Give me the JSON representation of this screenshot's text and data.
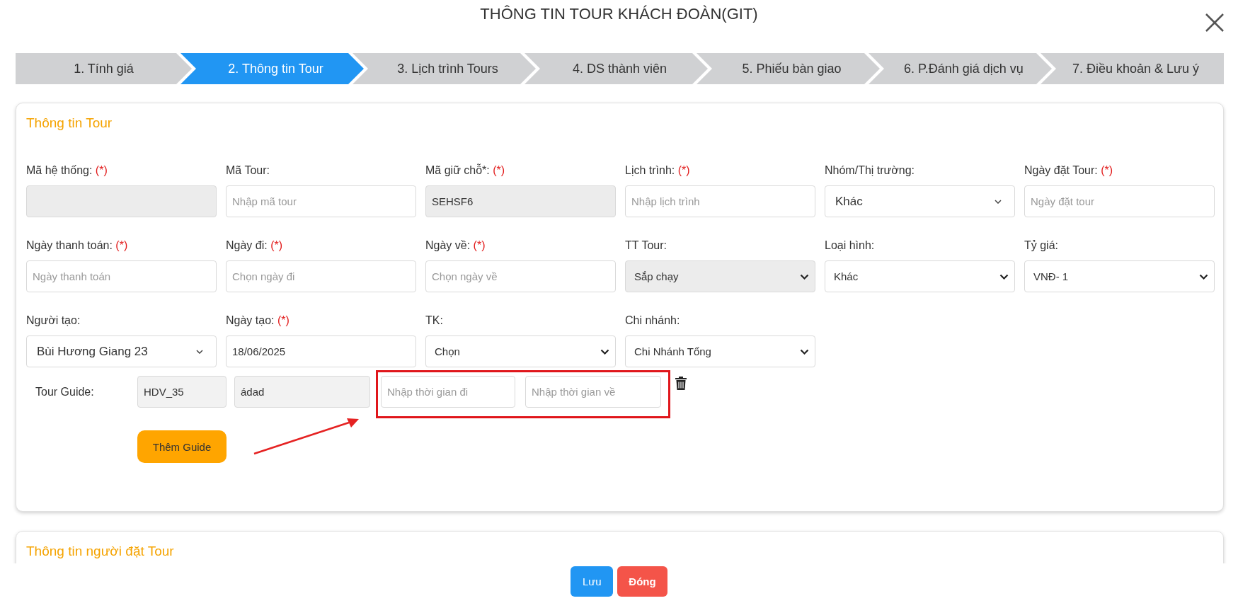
{
  "dialog": {
    "title": "THÔNG TIN TOUR KHÁCH ĐOÀN(GIT)"
  },
  "steps": [
    {
      "label": "1. Tính giá",
      "selected": false
    },
    {
      "label": "2. Thông tin Tour",
      "selected": true
    },
    {
      "label": "3. Lịch trình Tours",
      "selected": false
    },
    {
      "label": "4. DS thành viên",
      "selected": false
    },
    {
      "label": "5. Phiếu bàn giao",
      "selected": false
    },
    {
      "label": "6. P.Đánh giá dịch vụ",
      "selected": false
    },
    {
      "label": "7. Điều khoản & Lưu ý",
      "selected": false
    }
  ],
  "tour_info": {
    "title": "Thông tin Tour",
    "fields": [
      {
        "label": "Mã hệ thống:",
        "required_mark": "(*)",
        "kind": "input",
        "readonly": true
      },
      {
        "label": "Mã Tour:",
        "kind": "input",
        "readonly": false,
        "placeholder": "Nhập mã tour"
      },
      {
        "label": "Mã giữ chỗ*:",
        "required_mark": "(*)",
        "kind": "input",
        "readonly": true,
        "value": "SEHSF6"
      },
      {
        "label": "Lịch trình:",
        "required_mark": "(*)",
        "kind": "input",
        "readonly": false,
        "placeholder": "Nhập lịch trình"
      },
      {
        "label": "Nhóm/Thị trường:",
        "kind": "combo",
        "readonly": false,
        "value": "Khác"
      },
      {
        "label": "Ngày đặt Tour:",
        "required_mark": "(*)",
        "kind": "input",
        "readonly": false,
        "placeholder": "Ngày đặt tour"
      },
      {
        "label": "Ngày thanh toán:",
        "required_mark": "(*)",
        "kind": "input",
        "readonly": false,
        "placeholder": "Ngày thanh toán"
      },
      {
        "label": "Ngày đi:",
        "required_mark": "(*)",
        "kind": "input",
        "readonly": false,
        "placeholder": "Chọn ngày đi"
      },
      {
        "label": "Ngày về:",
        "required_mark": "(*)",
        "kind": "input",
        "readonly": false,
        "placeholder": "Chọn ngày về"
      },
      {
        "label": "TT Tour:",
        "kind": "select",
        "readonly": true,
        "value": "Sắp chạy"
      },
      {
        "label": "Loại hình:",
        "kind": "select",
        "readonly": false,
        "value": "Khác"
      },
      {
        "label": "Tỷ giá:",
        "kind": "select",
        "readonly": false,
        "value": "VNĐ- 1"
      },
      {
        "label": "Người tạo:",
        "kind": "combo",
        "readonly": false,
        "value": "Bùi Hương Giang 23"
      },
      {
        "label": "Ngày tạo:",
        "required_mark": "(*)",
        "kind": "input",
        "readonly": false,
        "value": "18/06/2025"
      },
      {
        "label": "TK:",
        "kind": "select",
        "readonly": false,
        "value": "Chọn"
      },
      {
        "label": "Chi nhánh:",
        "kind": "select",
        "readonly": false,
        "value": "Chi Nhánh Tổng"
      }
    ],
    "guide": {
      "label": "Tour Guide:",
      "code": "HDV_35",
      "name": "ádad",
      "depart_placeholder": "Nhập thời gian đi",
      "return_placeholder": "Nhập thời gian về"
    },
    "add_guide_button": "Thêm Guide"
  },
  "booker_info": {
    "title": "Thông tin người đặt Tour"
  },
  "buttons": [
    {
      "label": "Lưu",
      "kind": "primary"
    },
    {
      "label": "Đóng",
      "kind": "danger"
    }
  ]
}
